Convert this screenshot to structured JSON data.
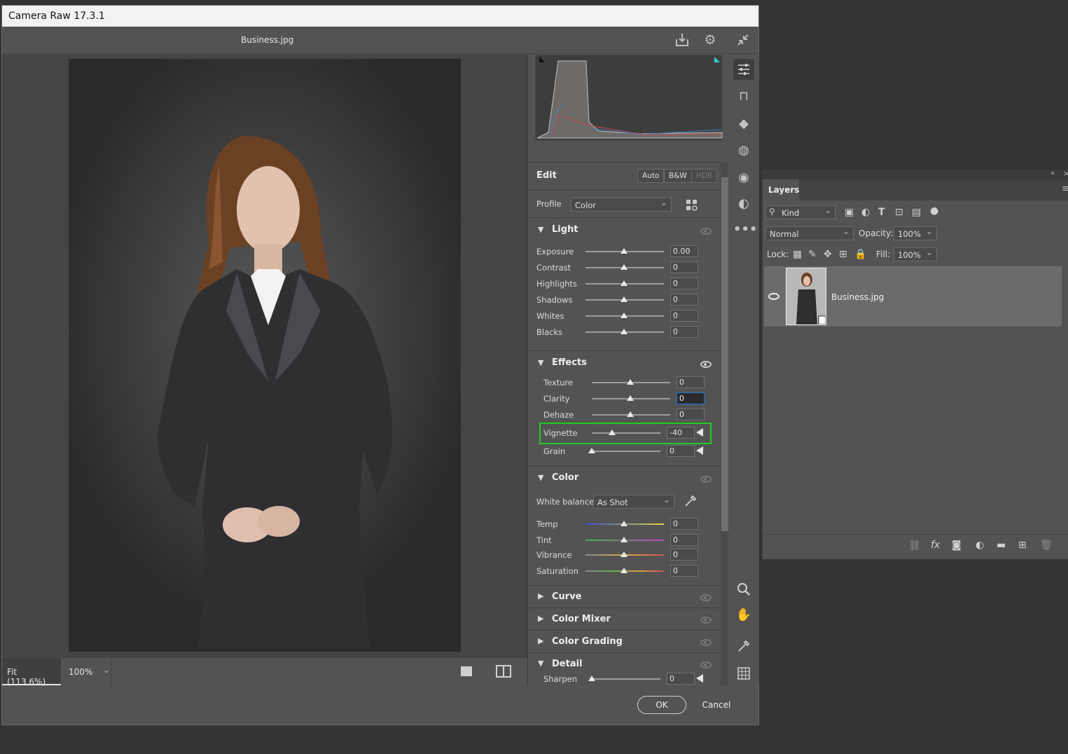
{
  "app": {
    "title": "Camera Raw 17.3.1",
    "filename": "Business.jpg"
  },
  "canvas": {
    "fit_label": "Fit (113.6%)",
    "zoom_label": "100%"
  },
  "edit": {
    "title": "Edit",
    "auto": "Auto",
    "bw": "B&W",
    "hdr": "HDR",
    "profile_label": "Profile",
    "profile_value": "Color"
  },
  "light": {
    "title": "Light",
    "rows": [
      {
        "label": "Exposure",
        "value": "0.00"
      },
      {
        "label": "Contrast",
        "value": "0"
      },
      {
        "label": "Highlights",
        "value": "0"
      },
      {
        "label": "Shadows",
        "value": "0"
      },
      {
        "label": "Whites",
        "value": "0"
      },
      {
        "label": "Blacks",
        "value": "0"
      }
    ]
  },
  "effects": {
    "title": "Effects",
    "rows": [
      {
        "label": "Texture",
        "value": "0"
      },
      {
        "label": "Clarity",
        "value": "0"
      },
      {
        "label": "Dehaze",
        "value": "0"
      },
      {
        "label": "Vignette",
        "value": "-40"
      },
      {
        "label": "Grain",
        "value": "0"
      }
    ]
  },
  "color": {
    "title": "Color",
    "wb_label": "White balance",
    "wb_value": "As Shot",
    "rows": [
      {
        "label": "Temp",
        "value": "0"
      },
      {
        "label": "Tint",
        "value": "0"
      },
      {
        "label": "Vibrance",
        "value": "0"
      },
      {
        "label": "Saturation",
        "value": "0"
      }
    ]
  },
  "collapsed": {
    "curve": "Curve",
    "mixer": "Color Mixer",
    "grading": "Color Grading"
  },
  "detail": {
    "title": "Detail",
    "sharpen_label": "Sharpen",
    "sharpen_value": "0"
  },
  "footer": {
    "ok": "OK",
    "cancel": "Cancel"
  },
  "layers": {
    "tab": "Layers",
    "kind": "Kind",
    "blend": "Normal",
    "opacity_label": "Opacity:",
    "opacity_value": "100%",
    "lock_label": "Lock:",
    "fill_label": "Fill:",
    "fill_value": "100%",
    "layer_name": "Business.jpg"
  },
  "colors": {
    "highlight": "#22cc22",
    "accent": "#1e73d8"
  }
}
